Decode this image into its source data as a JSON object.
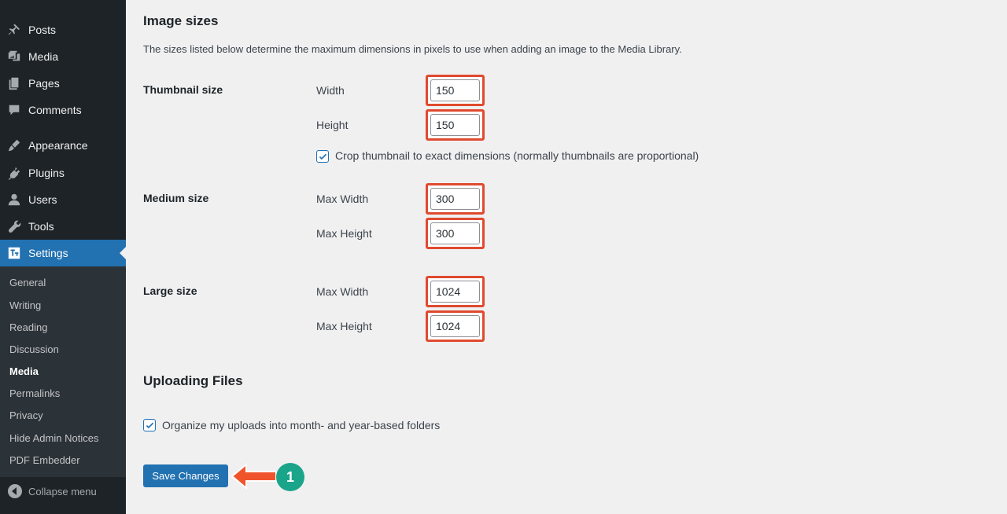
{
  "sidebar": {
    "items": [
      {
        "label": "Posts",
        "icon": "pushpin-icon"
      },
      {
        "label": "Media",
        "icon": "media-icon"
      },
      {
        "label": "Pages",
        "icon": "pages-icon"
      },
      {
        "label": "Comments",
        "icon": "comment-icon"
      },
      {
        "label": "Appearance",
        "icon": "paintbrush-icon"
      },
      {
        "label": "Plugins",
        "icon": "plugin-icon"
      },
      {
        "label": "Users",
        "icon": "user-icon"
      },
      {
        "label": "Tools",
        "icon": "wrench-icon"
      },
      {
        "label": "Settings",
        "icon": "settings-icon"
      }
    ],
    "submenu": [
      "General",
      "Writing",
      "Reading",
      "Discussion",
      "Media",
      "Permalinks",
      "Privacy",
      "Hide Admin Notices",
      "PDF Embedder"
    ],
    "current_submenu": "Media",
    "collapse_label": "Collapse menu"
  },
  "image_sizes": {
    "heading": "Image sizes",
    "description": "The sizes listed below determine the maximum dimensions in pixels to use when adding an image to the Media Library.",
    "thumbnail": {
      "label": "Thumbnail size",
      "width_label": "Width",
      "width_value": "150",
      "height_label": "Height",
      "height_value": "150",
      "crop_label": "Crop thumbnail to exact dimensions (normally thumbnails are proportional)",
      "crop_checked": true
    },
    "medium": {
      "label": "Medium size",
      "width_label": "Max Width",
      "width_value": "300",
      "height_label": "Max Height",
      "height_value": "300"
    },
    "large": {
      "label": "Large size",
      "width_label": "Max Width",
      "width_value": "1024",
      "height_label": "Max Height",
      "height_value": "1024"
    }
  },
  "uploading": {
    "heading": "Uploading Files",
    "organize_label": "Organize my uploads into month- and year-based folders",
    "organize_checked": true
  },
  "actions": {
    "save_label": "Save Changes",
    "step_badge": "1"
  },
  "colors": {
    "sidebar_bg": "#1d2327",
    "accent": "#2271b1",
    "highlight": "#e04a2f",
    "badge": "#1aa58a"
  }
}
